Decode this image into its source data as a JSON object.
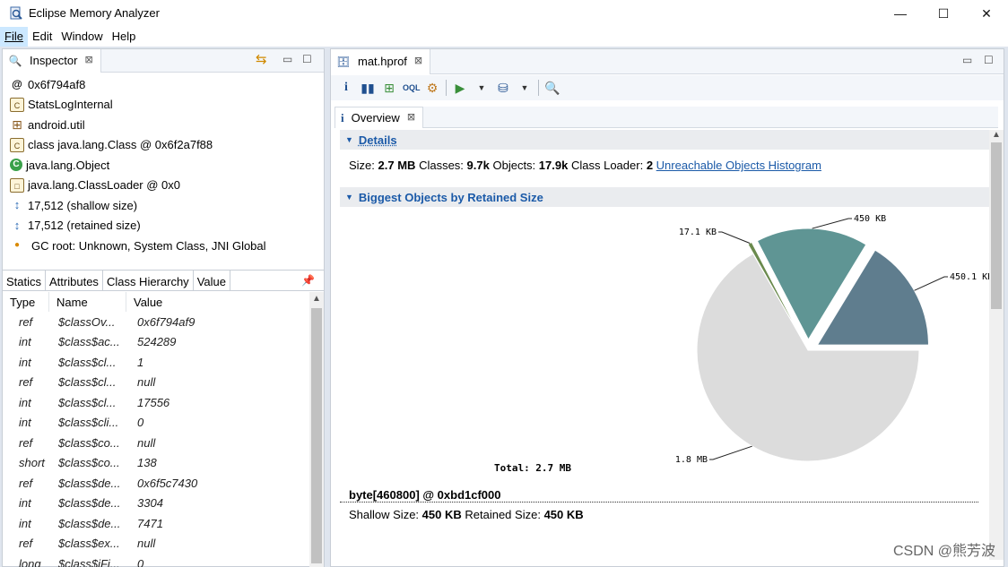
{
  "window": {
    "title": "Eclipse Memory Analyzer",
    "minimize": "—",
    "maximize": "☐",
    "close": "✕"
  },
  "menu": [
    "File",
    "Edit",
    "Window",
    "Help"
  ],
  "inspector": {
    "tab_label": "Inspector",
    "rows": [
      {
        "icon": "@",
        "text": "0x6f794af8"
      },
      {
        "icon": "class",
        "text": "StatsLogInternal"
      },
      {
        "icon": "package",
        "text": "android.util"
      },
      {
        "icon": "class",
        "text": "class java.lang.Class @ 0x6f2a7f88"
      },
      {
        "icon": "object",
        "text": "java.lang.Object"
      },
      {
        "icon": "loader",
        "text": "java.lang.ClassLoader @ 0x0"
      },
      {
        "icon": "size",
        "text": "17,512 (shallow size)"
      },
      {
        "icon": "size",
        "text": "17,512 (retained size)"
      },
      {
        "icon": "dot",
        "text": "GC root: Unknown, System Class, JNI Global"
      }
    ],
    "tabs": [
      "Statics",
      "Attributes",
      "Class Hierarchy",
      "Value"
    ],
    "columns": [
      "Type",
      "Name",
      "Value"
    ],
    "fields": [
      {
        "type": "ref",
        "name": "$classOv...",
        "value": "0x6f794af9"
      },
      {
        "type": "int",
        "name": "$class$ac...",
        "value": "524289"
      },
      {
        "type": "int",
        "name": "$class$cl...",
        "value": "1"
      },
      {
        "type": "ref",
        "name": "$class$cl...",
        "value": "null"
      },
      {
        "type": "int",
        "name": "$class$cl...",
        "value": "17556"
      },
      {
        "type": "int",
        "name": "$class$cli...",
        "value": "0"
      },
      {
        "type": "ref",
        "name": "$class$co...",
        "value": "null"
      },
      {
        "type": "short",
        "name": "$class$co...",
        "value": "138"
      },
      {
        "type": "ref",
        "name": "$class$de...",
        "value": "0x6f5c7430"
      },
      {
        "type": "int",
        "name": "$class$de...",
        "value": "3304"
      },
      {
        "type": "int",
        "name": "$class$de...",
        "value": "7471"
      },
      {
        "type": "ref",
        "name": "$class$ex...",
        "value": "null"
      },
      {
        "type": "long",
        "name": "$class$iFi...",
        "value": "0"
      }
    ]
  },
  "editor": {
    "tab_label": "mat.hprof",
    "subtab_label": "Overview",
    "details": {
      "heading": "Details",
      "size_label": "Size:",
      "size": "2.7 MB",
      "classes_label": "Classes:",
      "classes": "9.7k",
      "objects_label": "Objects:",
      "objects": "17.9k",
      "loader_label": "Class Loader:",
      "loader": "2",
      "link": "Unreachable Objects Histogram"
    },
    "biggest": {
      "heading": "Biggest Objects by Retained Size",
      "total": "Total: 2.7 MB"
    },
    "object_line": "byte[460800] @ 0xbd1cf000",
    "object_sub_prefix": "Shallow Size:",
    "object_shallow": "450 KB",
    "object_sub_mid": "Retained Size:",
    "object_retained": "450 KB"
  },
  "chart_data": {
    "type": "pie",
    "title": "",
    "total_label": "Total: 2.7 MB",
    "slices": [
      {
        "label": "450.1 KB",
        "value": 450.1,
        "color": "#5f7d8e",
        "exploded": true
      },
      {
        "label": "450 KB",
        "value": 450,
        "color": "#5f9594",
        "exploded": true
      },
      {
        "label": "17.1 KB",
        "value": 17.1,
        "color": "#6a8a4d",
        "exploded": true
      },
      {
        "label": "1.8 MB",
        "value": 1843,
        "color": "#dcdcdc",
        "exploded": false
      }
    ]
  },
  "watermark": "CSDN @熊芳波"
}
